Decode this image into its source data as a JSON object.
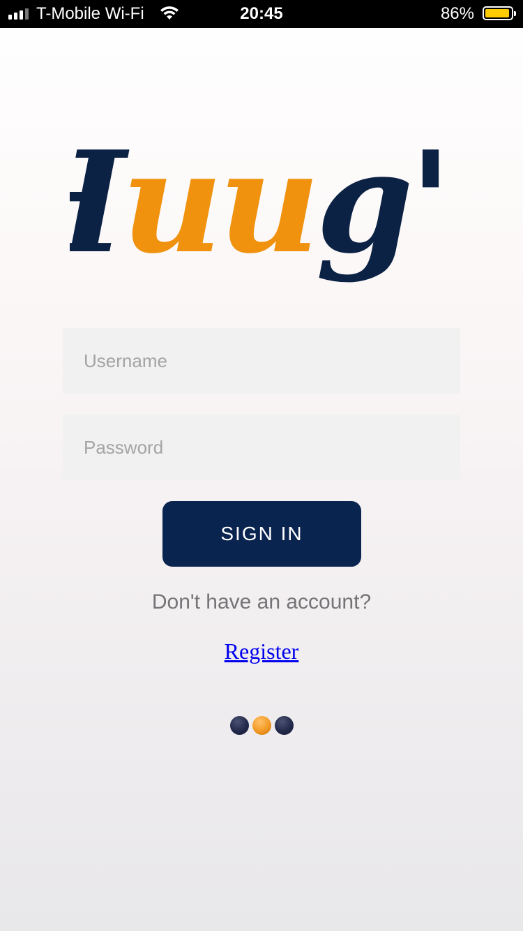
{
  "status_bar": {
    "carrier": "T-Mobile Wi-Fi",
    "time": "20:45",
    "battery_percent": "86%",
    "battery_level": 0.86,
    "battery_color": "#ffcc00"
  },
  "logo": {
    "text": "Huug's",
    "part_navy_1": "H",
    "part_orange": "uu",
    "part_navy_2": "g's",
    "navy_color": "#0b2244",
    "orange_color": "#f0920e"
  },
  "form": {
    "username_placeholder": "Username",
    "username_value": "",
    "password_placeholder": "Password",
    "password_value": "",
    "signin_label": "SIGN IN"
  },
  "footer": {
    "prompt": "Don't have an account?",
    "register_label": "Register"
  },
  "loader": {
    "dots": [
      "navy",
      "orange",
      "navy"
    ]
  },
  "colors": {
    "primary": "#0a2450",
    "accent": "#f29a25",
    "link": "#0000ee"
  }
}
